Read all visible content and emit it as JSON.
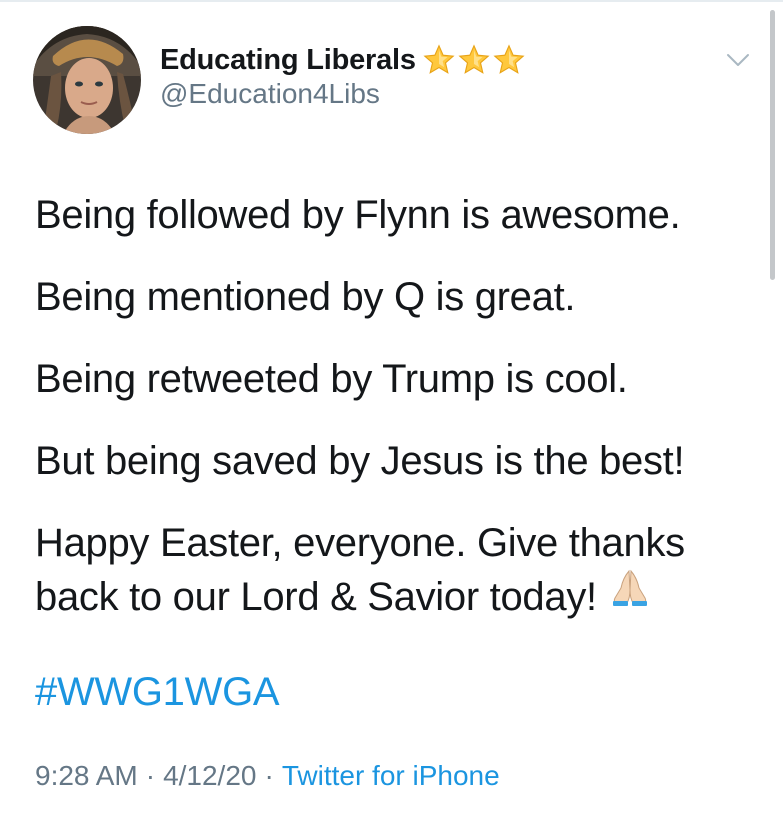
{
  "profile": {
    "display_name": "Educating Liberals",
    "handle": "@Education4Libs",
    "badge_icons": [
      "star-icon",
      "star-icon",
      "star-icon"
    ]
  },
  "tweet": {
    "lines": [
      "Being followed by Flynn is awesome.",
      "Being mentioned by Q is great.",
      "Being retweeted by Trump is cool.",
      "But being saved by Jesus is the best!",
      "Happy Easter, everyone. Give thanks",
      "back to our Lord & Savior today!"
    ],
    "emoji": "folded-hands-icon",
    "hashtag": "#WWG1WGA"
  },
  "meta": {
    "time": "9:28 AM",
    "separator": "·",
    "date": "4/12/20",
    "source": "Twitter for iPhone"
  },
  "colors": {
    "text": "#14171a",
    "secondary": "#657786",
    "link": "#1b95e0",
    "star": "#ffc83d"
  }
}
